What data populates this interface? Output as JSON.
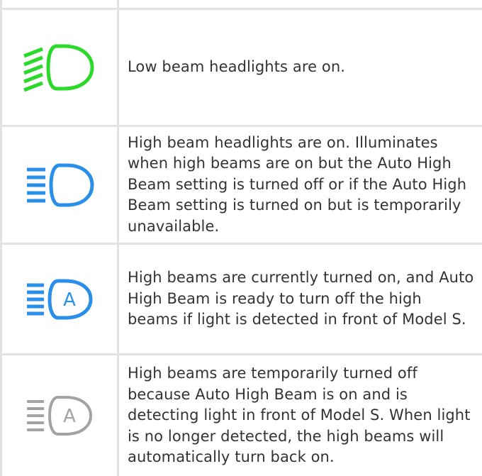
{
  "rows": [
    {
      "icon": "low-beam-icon",
      "color": "#2bd92b",
      "text": "Low beam headlights are on."
    },
    {
      "icon": "high-beam-icon",
      "color": "#2a8fe8",
      "text": "High beam headlights are on. Illuminates when high beams are on but the Auto High Beam setting is turned off or if the Auto High Beam setting is turned on but is temporarily unavailable."
    },
    {
      "icon": "auto-high-beam-active-icon",
      "color": "#2a8fe8",
      "text": "High beams are currently turned on, and Auto High Beam is ready to turn off the high beams if light is detected in front of Model S."
    },
    {
      "icon": "auto-high-beam-standby-icon",
      "color": "#a3a3a3",
      "text": "High beams are temporarily turned off because Auto High Beam is on and is detecting light in front of Model S. When light is no longer detected, the high beams will automatically turn back on."
    }
  ],
  "icon_letters": {
    "auto": "A"
  }
}
